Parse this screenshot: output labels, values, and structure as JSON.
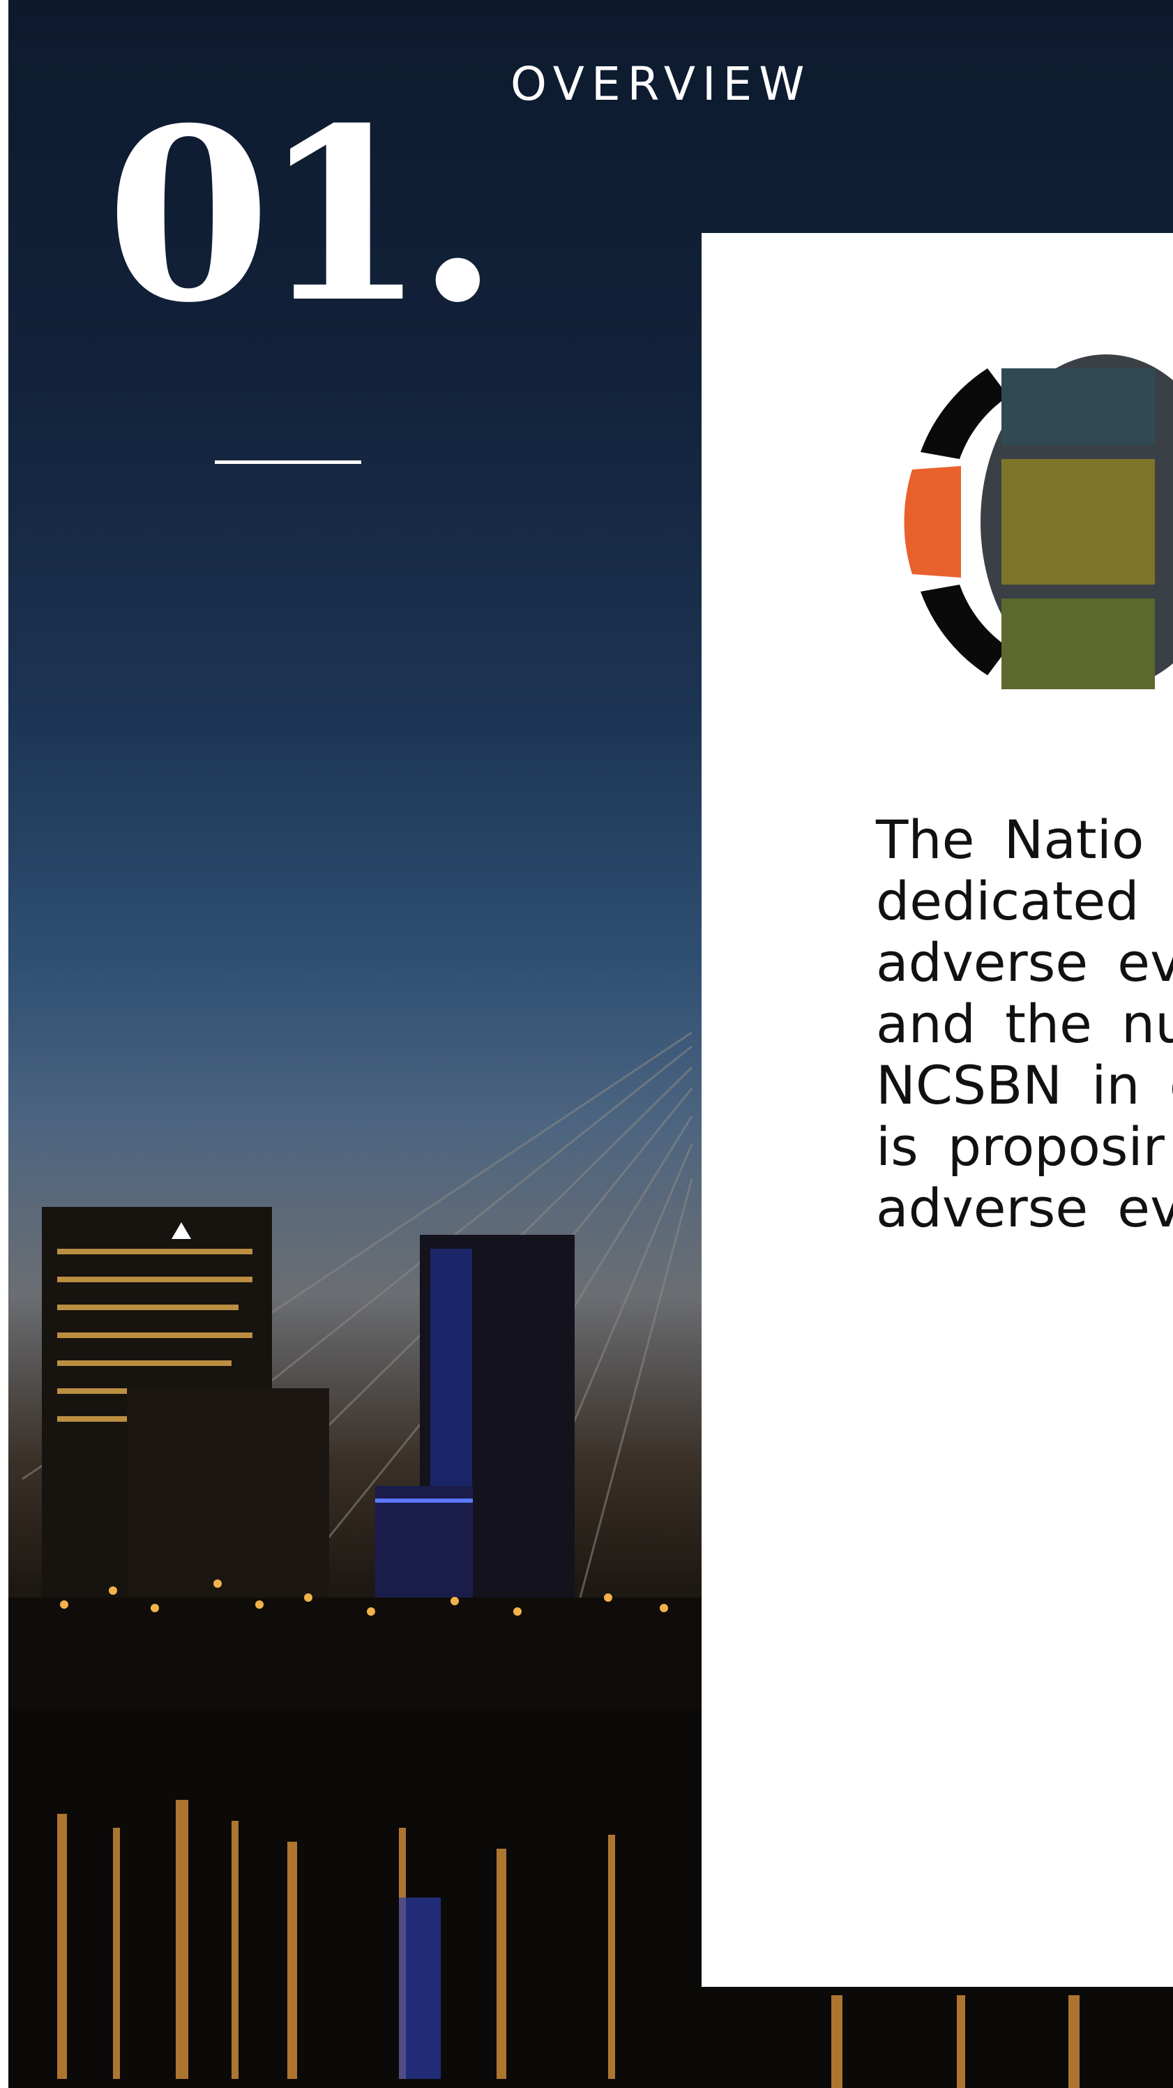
{
  "section": {
    "number": "01.",
    "label": "OVERVIEW"
  },
  "body": {
    "lines": [
      "The Natio",
      "dedicated",
      "adverse ev",
      "and the nu",
      "NCSBN in c",
      "is proposir",
      "adverse ev"
    ]
  },
  "colors": {
    "sky_top": "#0d1a2e",
    "accent_orange": "#e8612c",
    "card_bg": "#ffffff",
    "text": "#111111"
  },
  "icons": {
    "emblem": "globe-logo-icon"
  }
}
